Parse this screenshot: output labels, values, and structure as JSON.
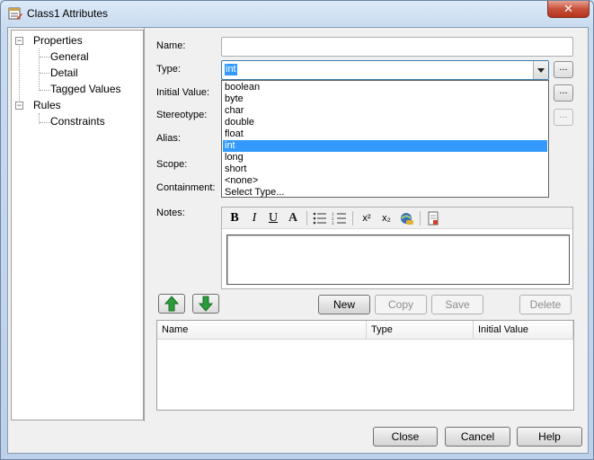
{
  "window": {
    "title": "Class1 Attributes",
    "close_glyph": "✕"
  },
  "tree": {
    "properties": "Properties",
    "general": "General",
    "detail": "Detail",
    "tagged_values": "Tagged Values",
    "rules": "Rules",
    "constraints": "Constraints",
    "expander_symbol": "−"
  },
  "form": {
    "name_label": "Name:",
    "name_value": "",
    "type_label": "Type:",
    "type_value": "int",
    "initial_value_label": "Initial Value:",
    "stereotype_label": "Stereotype:",
    "alias_label": "Alias:",
    "scope_label": "Scope:",
    "containment_label": "Containment:",
    "notes_label": "Notes:",
    "ellipsis": "..."
  },
  "type_options": [
    "boolean",
    "byte",
    "char",
    "double",
    "float",
    "int",
    "long",
    "short",
    "<none>",
    "Select Type..."
  ],
  "type_selected_index": 5,
  "toolbar": {
    "bold": "B",
    "italic": "I",
    "underline": "U",
    "font_color": "A",
    "superscript": "x²",
    "subscript": "x₂"
  },
  "actions": {
    "new": "New",
    "copy": "Copy",
    "save": "Save",
    "delete": "Delete"
  },
  "grid_headers": [
    "Name",
    "Type",
    "Initial Value"
  ],
  "footer": {
    "close": "Close",
    "cancel": "Cancel",
    "help": "Help"
  },
  "colors": {
    "selection": "#3399ff",
    "move_arrow": "#2a9d3a"
  }
}
